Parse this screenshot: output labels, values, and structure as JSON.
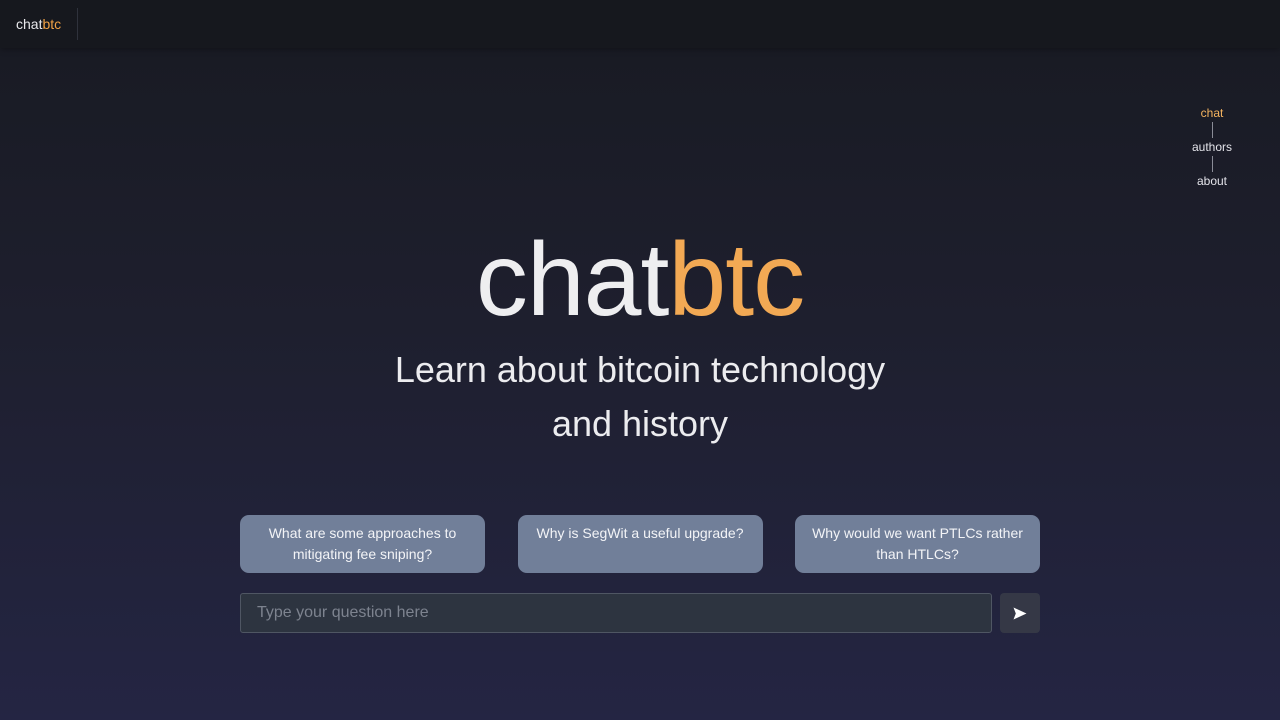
{
  "header": {
    "brand_part1": "chat",
    "brand_part2": "btc"
  },
  "nav": {
    "items": [
      {
        "label": "chat",
        "active": true
      },
      {
        "label": "authors",
        "active": false
      },
      {
        "label": "about",
        "active": false
      }
    ]
  },
  "hero": {
    "logo_part1": "chat",
    "logo_part2": "btc",
    "tagline_line1": "Learn about bitcoin technology",
    "tagline_line2": "and history"
  },
  "suggestions": [
    {
      "text": "What are some approaches to mitigating fee sniping?"
    },
    {
      "text": "Why is SegWit a useful upgrade?"
    },
    {
      "text": "Why would we want PTLCs rather than HTLCs?"
    }
  ],
  "input": {
    "placeholder": "Type your question here",
    "value": ""
  },
  "send": {
    "icon": "send-icon"
  },
  "colors": {
    "accent": "#f2a954",
    "nav_active": "#f5b45f",
    "suggestion_bg": "#717f99",
    "input_bg": "#2d3440",
    "topbar_bg": "#16181e"
  }
}
